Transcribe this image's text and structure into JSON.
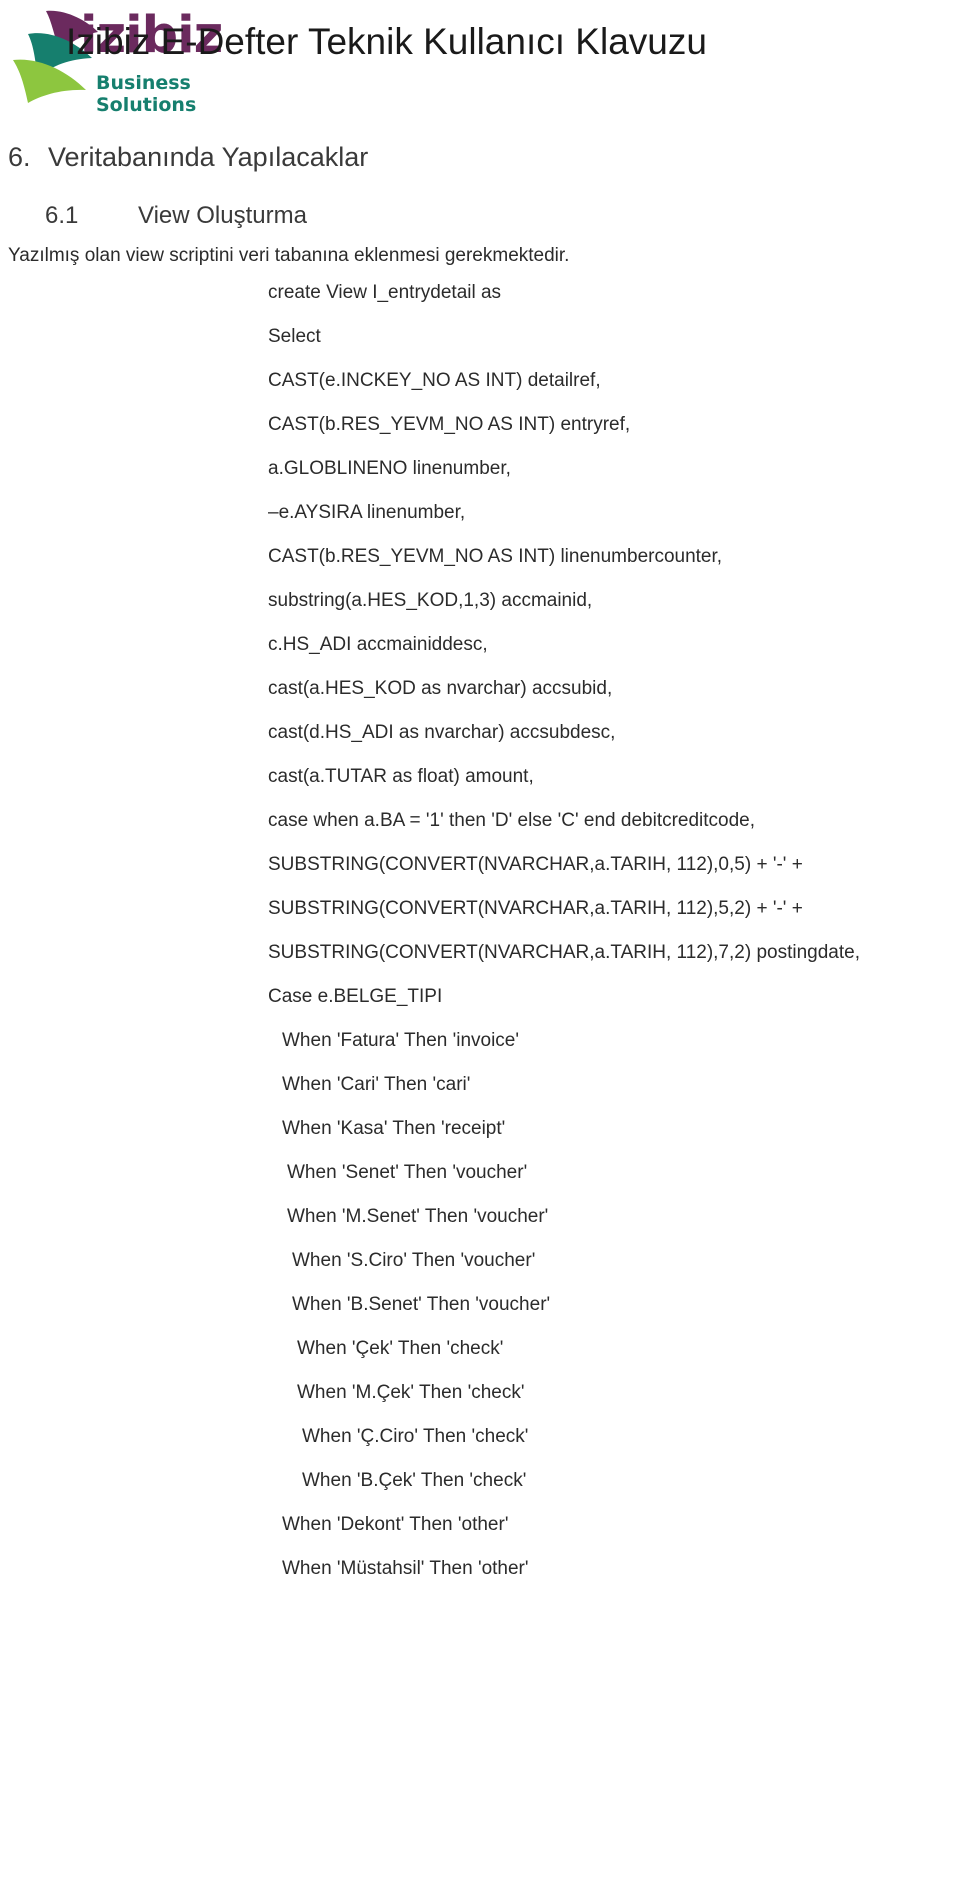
{
  "header": {
    "logo": {
      "wordmark": "izibiz",
      "tagline": "Business Solutions",
      "leaf_colors": [
        "#6B2A5E",
        "#167F6E",
        "#8DC63F"
      ],
      "wordmark_color": "#6B2A5E",
      "tagline_color": "#167F6E"
    },
    "document_title": "Izibiz E-Defter Teknik Kullanıcı Klavuzu"
  },
  "headings": {
    "section_number": "6.",
    "section_title": "Veritabanında Yapılacaklar",
    "subsection_number": "6.1",
    "subsection_title": "View Oluşturma"
  },
  "intro_text": "Yazılmış olan view scriptini veri tabanına eklenmesi gerekmektedir.",
  "code_lines": [
    {
      "indent": 268,
      "text": "create View I_entrydetail as"
    },
    {
      "indent": 268,
      "text": "Select"
    },
    {
      "indent": 268,
      "text": "CAST(e.INCKEY_NO AS INT) detailref,"
    },
    {
      "indent": 268,
      "text": "CAST(b.RES_YEVM_NO AS INT) entryref,"
    },
    {
      "indent": 268,
      "text": "a.GLOBLINENO  linenumber,"
    },
    {
      "indent": 268,
      "text": "–e.AYSIRA linenumber,"
    },
    {
      "indent": 268,
      "text": "CAST(b.RES_YEVM_NO AS INT) linenumbercounter,"
    },
    {
      "indent": 268,
      "text": "substring(a.HES_KOD,1,3) accmainid,"
    },
    {
      "indent": 268,
      "text": "c.HS_ADI accmainiddesc,"
    },
    {
      "indent": 268,
      "text": "cast(a.HES_KOD as nvarchar) accsubid,"
    },
    {
      "indent": 268,
      "text": "cast(d.HS_ADI as nvarchar) accsubdesc,"
    },
    {
      "indent": 268,
      "text": "cast(a.TUTAR as float) amount,"
    },
    {
      "indent": 268,
      "text": "case when a.BA = '1' then 'D' else 'C' end debitcreditcode,"
    },
    {
      "indent": 268,
      "text": "SUBSTRING(CONVERT(NVARCHAR,a.TARIH, 112),0,5) + '-' +"
    },
    {
      "indent": 268,
      "text": "SUBSTRING(CONVERT(NVARCHAR,a.TARIH, 112),5,2) + '-' +"
    },
    {
      "indent": 268,
      "text": "SUBSTRING(CONVERT(NVARCHAR,a.TARIH, 112),7,2) postingdate,"
    },
    {
      "indent": 268,
      "text": "Case e.BELGE_TIPI"
    },
    {
      "indent": 282,
      "text": "When 'Fatura' Then 'invoice'"
    },
    {
      "indent": 282,
      "text": "When 'Cari' Then 'cari'"
    },
    {
      "indent": 282,
      "text": "When 'Kasa' Then 'receipt'"
    },
    {
      "indent": 287,
      "text": "When 'Senet' Then 'voucher'"
    },
    {
      "indent": 287,
      "text": "When 'M.Senet' Then 'voucher'"
    },
    {
      "indent": 292,
      "text": "When 'S.Ciro' Then 'voucher'"
    },
    {
      "indent": 292,
      "text": "When 'B.Senet' Then 'voucher'"
    },
    {
      "indent": 297,
      "text": "When 'Çek' Then 'check'"
    },
    {
      "indent": 297,
      "text": "When 'M.Çek' Then 'check'"
    },
    {
      "indent": 302,
      "text": "When 'Ç.Ciro' Then 'check'"
    },
    {
      "indent": 302,
      "text": "When 'B.Çek' Then 'check'"
    },
    {
      "indent": 282,
      "text": "When 'Dekont' Then 'other'"
    },
    {
      "indent": 282,
      "text": "When 'Müstahsil' Then 'other'"
    }
  ]
}
